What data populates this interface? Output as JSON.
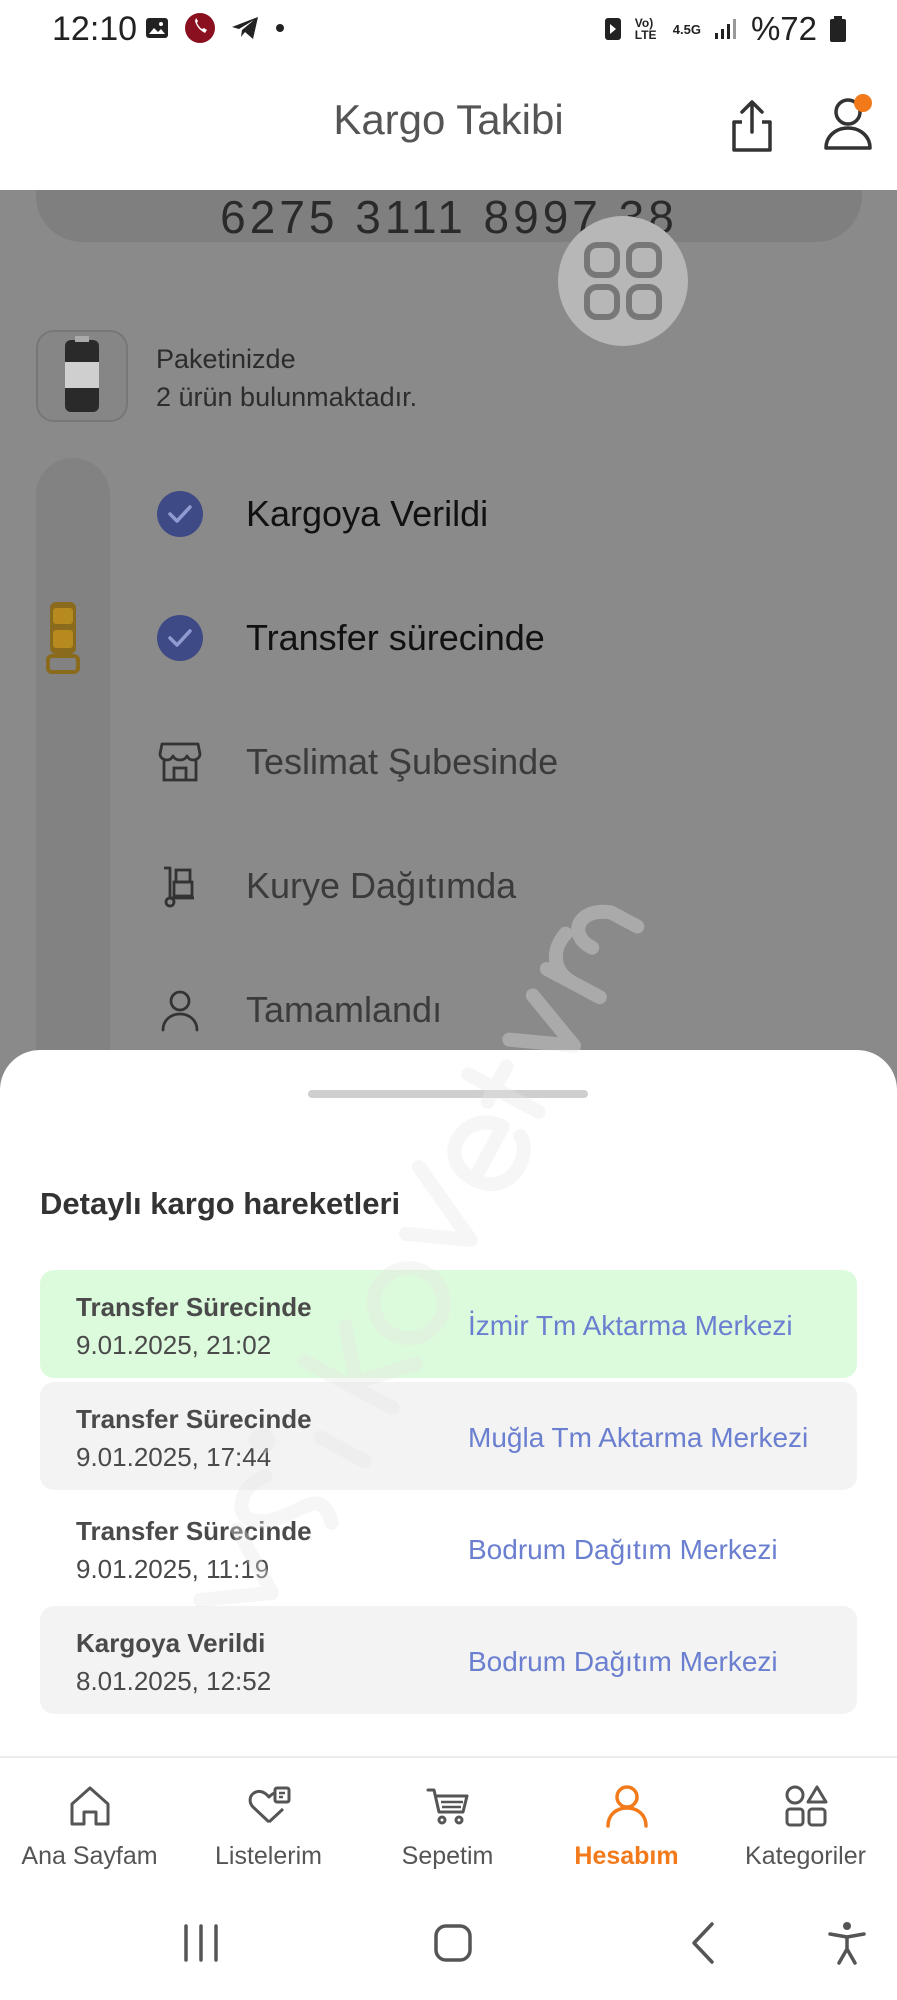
{
  "status_bar": {
    "time": "12:10",
    "battery": "%72",
    "network": "4.5G",
    "volte": "Vo) LTE"
  },
  "header": {
    "title": "Kargo Takibi"
  },
  "tracking": {
    "number": "6275 3111 8997 38"
  },
  "package": {
    "line1": "Paketinizde",
    "line2": "2 ürün bulunmaktadır."
  },
  "steps": [
    {
      "label": "Kargoya Verildi",
      "state": "done",
      "icon": "check-icon"
    },
    {
      "label": "Transfer sürecinde",
      "state": "done",
      "icon": "check-icon"
    },
    {
      "label": "Teslimat Şubesinde",
      "state": "todo",
      "icon": "store-icon"
    },
    {
      "label": "Kurye Dağıtımda",
      "state": "todo",
      "icon": "courier-icon"
    },
    {
      "label": "Tamamlandı",
      "state": "todo",
      "icon": "person-icon"
    }
  ],
  "sheet": {
    "title": "Detaylı kargo hareketleri",
    "moves": [
      {
        "status": "Transfer Sürecinde",
        "date": "9.01.2025, 21:02",
        "location": "İzmir Tm Aktarma Merkezi"
      },
      {
        "status": "Transfer Sürecinde",
        "date": "9.01.2025, 17:44",
        "location": "Muğla Tm Aktarma Merkezi"
      },
      {
        "status": "Transfer Sürecinde",
        "date": "9.01.2025, 11:19",
        "location": "Bodrum Dağıtım Merkezi"
      },
      {
        "status": "Kargoya Verildi",
        "date": "8.01.2025, 12:52",
        "location": "Bodrum Dağıtım Merkezi"
      }
    ]
  },
  "bottom_nav": {
    "items": [
      {
        "label": "Ana Sayfam",
        "icon": "home-icon"
      },
      {
        "label": "Listelerim",
        "icon": "heart-list-icon"
      },
      {
        "label": "Sepetim",
        "icon": "cart-icon"
      },
      {
        "label": "Hesabım",
        "icon": "account-icon"
      },
      {
        "label": "Kategoriler",
        "icon": "categories-icon"
      }
    ],
    "active_index": 3
  },
  "colors": {
    "accent": "#f27a1a",
    "link": "#6b7fd0",
    "check": "#3e4a86",
    "highlight_row": "#dcfbdc"
  }
}
